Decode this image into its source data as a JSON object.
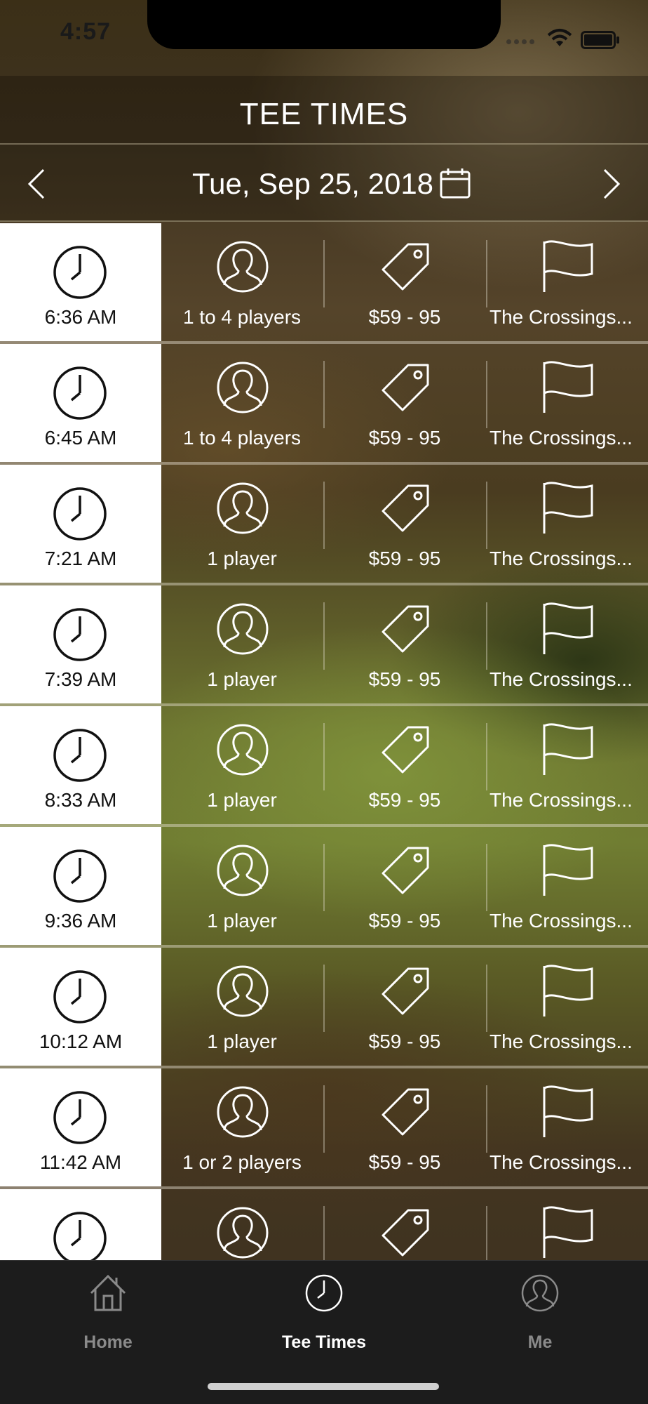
{
  "status_bar": {
    "time": "4:57"
  },
  "header": {
    "title": "TEE TIMES"
  },
  "date_nav": {
    "date": "Tue, Sep 25, 2018"
  },
  "tee_times": [
    {
      "time": "6:36 AM",
      "players": "1 to 4 players",
      "price": "$59 - 95",
      "course": "The Crossings..."
    },
    {
      "time": "6:45 AM",
      "players": "1 to 4 players",
      "price": "$59 - 95",
      "course": "The Crossings..."
    },
    {
      "time": "7:21 AM",
      "players": "1 player",
      "price": "$59 - 95",
      "course": "The Crossings..."
    },
    {
      "time": "7:39 AM",
      "players": "1 player",
      "price": "$59 - 95",
      "course": "The Crossings..."
    },
    {
      "time": "8:33 AM",
      "players": "1 player",
      "price": "$59 - 95",
      "course": "The Crossings..."
    },
    {
      "time": "9:36 AM",
      "players": "1 player",
      "price": "$59 - 95",
      "course": "The Crossings..."
    },
    {
      "time": "10:12 AM",
      "players": "1 player",
      "price": "$59 - 95",
      "course": "The Crossings..."
    },
    {
      "time": "11:42 AM",
      "players": "1 or 2 players",
      "price": "$59 - 95",
      "course": "The Crossings..."
    },
    {
      "time": "",
      "players": "",
      "price": "",
      "course": ""
    }
  ],
  "tab_bar": {
    "home_label": "Home",
    "tee_times_label": "Tee Times",
    "me_label": "Me"
  },
  "colors": {
    "accent": "#ffffff",
    "tab_inactive": "#8a8a8a",
    "tab_bar_bg": "#1c1c1c"
  },
  "icons": [
    "clock-icon",
    "person-icon",
    "price-tag-icon",
    "flag-icon",
    "calendar-icon",
    "chevron-left-icon",
    "chevron-right-icon",
    "home-icon"
  ]
}
